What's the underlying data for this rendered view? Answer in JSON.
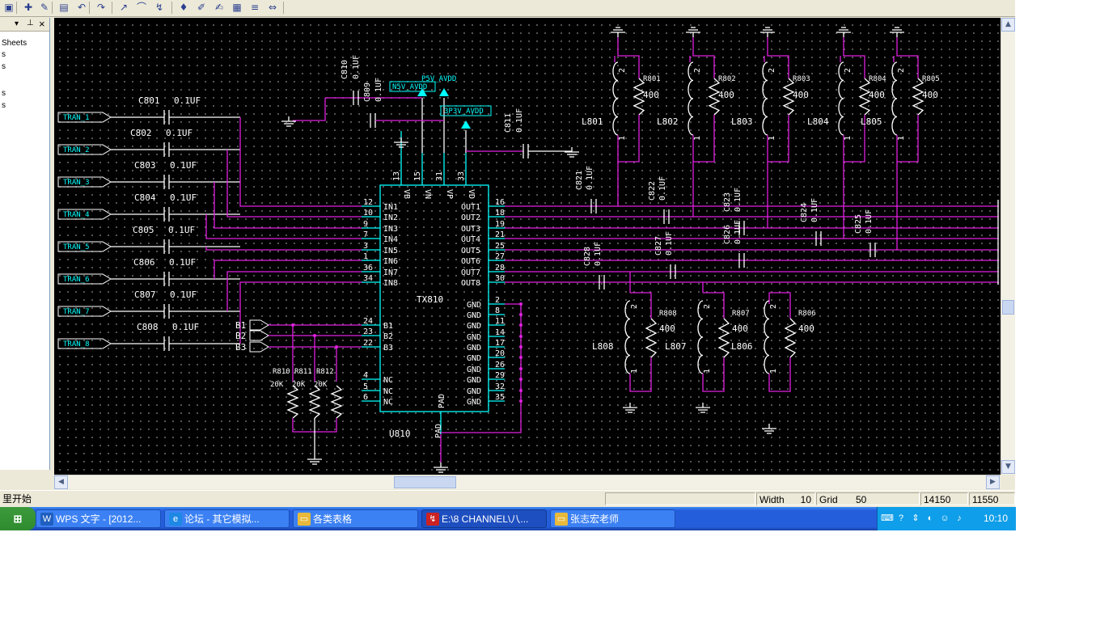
{
  "toolbar": {
    "icons": [
      "sheet-icon",
      "place-part-icon",
      "place-wire-icon",
      "clipboard-icon",
      "undo-icon",
      "redo-icon",
      "place-line-icon",
      "place-arc-icon",
      "place-junction-icon",
      "place-power-icon",
      "edit-part-icon",
      "place-text-icon",
      "place-bus-icon",
      "place-net-icon",
      "annotate-icon"
    ]
  },
  "panel": {
    "header": {
      "menu_glyph": "▾",
      "pin_glyph": "⊥",
      "close_glyph": "×"
    },
    "items": [
      "Sheets",
      "s",
      "s",
      "s",
      "s"
    ]
  },
  "status": {
    "left_text": "里开始",
    "width_label": "Width",
    "width_value": "10",
    "grid_label": "Grid",
    "grid_value": "50",
    "x_coord": "14150",
    "y_coord": "11550"
  },
  "taskbar": {
    "start_glyph": "⊞",
    "tasks": [
      {
        "icon": "W",
        "label": "WPS 文字 - [2012...",
        "icon_color": "#1f5fbf"
      },
      {
        "icon": "e",
        "label": "论坛 - 其它模拟...",
        "icon_color": "#1e88e5"
      },
      {
        "icon": "▭",
        "label": "各类表格",
        "icon_color": "#e8b93a"
      },
      {
        "icon": "↯",
        "label": "E:\\8 CHANNEL\\八...",
        "icon_color": "#cc2222"
      },
      {
        "icon": "▭",
        "label": "张志宏老师",
        "icon_color": "#e8b93a"
      }
    ],
    "tray_icons": [
      "keyboard-icon",
      "help-icon",
      "arrow-icon",
      "network-icon",
      "qq-icon",
      "speaker-icon"
    ],
    "clock": "10:10"
  },
  "schematic": {
    "colors": {
      "wire": "#e020e0",
      "part": "#ffffff",
      "label": "#00ffff",
      "pin": "#00ffff",
      "power": "#00ffff",
      "grid": "#6b6b6b",
      "bg": "#000000"
    },
    "chip": {
      "refdes": "U810",
      "part_name": "TX810",
      "top_pins": [
        {
          "num": "13",
          "name": "VB"
        },
        {
          "num": "15",
          "name": "VN"
        },
        {
          "num": "31",
          "name": "VP"
        },
        {
          "num": "33",
          "name": "VD"
        }
      ],
      "left_pins": [
        {
          "num": "12",
          "name": "IN1"
        },
        {
          "num": "10",
          "name": "IN2"
        },
        {
          "num": "9",
          "name": "IN3"
        },
        {
          "num": "7",
          "name": "IN4"
        },
        {
          "num": "3",
          "name": "IN5"
        },
        {
          "num": "1",
          "name": "IN6"
        },
        {
          "num": "36",
          "name": "IN7"
        },
        {
          "num": "34",
          "name": "IN8"
        },
        {
          "num": "24",
          "name": "B1"
        },
        {
          "num": "23",
          "name": "B2"
        },
        {
          "num": "22",
          "name": "B3"
        },
        {
          "num": "4",
          "name": "NC"
        },
        {
          "num": "5",
          "name": "NC"
        },
        {
          "num": "6",
          "name": "NC"
        }
      ],
      "right_pins": [
        {
          "num": "16",
          "name": "OUT1"
        },
        {
          "num": "18",
          "name": "OUT2"
        },
        {
          "num": "19",
          "name": "OUT3"
        },
        {
          "num": "21",
          "name": "OUT4"
        },
        {
          "num": "25",
          "name": "OUT5"
        },
        {
          "num": "27",
          "name": "OUT6"
        },
        {
          "num": "28",
          "name": "OUT7"
        },
        {
          "num": "30",
          "name": "OUT8"
        },
        {
          "num": "2",
          "name": "GND"
        },
        {
          "num": "8",
          "name": "GND"
        },
        {
          "num": "11",
          "name": "GND"
        },
        {
          "num": "14",
          "name": "GND"
        },
        {
          "num": "17",
          "name": "GND"
        },
        {
          "num": "20",
          "name": "GND"
        },
        {
          "num": "26",
          "name": "GND"
        },
        {
          "num": "29",
          "name": "GND"
        },
        {
          "num": "32",
          "name": "GND"
        },
        {
          "num": "35",
          "name": "GND"
        }
      ],
      "pad_label": "PAD",
      "pad_pin": "PAD"
    },
    "inputs": [
      "TRAN_1",
      "TRAN_2",
      "TRAN_3",
      "TRAN_4",
      "TRAN_5",
      "TRAN_6",
      "TRAN_7",
      "TRAN_8"
    ],
    "input_caps": [
      {
        "ref": "C801",
        "value": "0.1UF"
      },
      {
        "ref": "C802",
        "value": "0.1UF"
      },
      {
        "ref": "C803",
        "value": "0.1UF"
      },
      {
        "ref": "C804",
        "value": "0.1UF"
      },
      {
        "ref": "C805",
        "value": "0.1UF"
      },
      {
        "ref": "C806",
        "value": "0.1UF"
      },
      {
        "ref": "C807",
        "value": "0.1UF"
      },
      {
        "ref": "C808",
        "value": "0.1UF"
      }
    ],
    "b_ports": [
      "B1",
      "B2",
      "B3"
    ],
    "b_resistors": [
      {
        "ref": "R810",
        "value": "20K"
      },
      {
        "ref": "R811",
        "value": "20K"
      },
      {
        "ref": "R812",
        "value": "20K"
      }
    ],
    "power_nets": {
      "p5v": "P5V_AVDD",
      "n5v": "N5V_AVDD",
      "p3v3": "3P3V_AVDD"
    },
    "supply_caps": [
      {
        "ref": "C810",
        "value": "0.1UF"
      },
      {
        "ref": "C809",
        "value": "0.1UF"
      },
      {
        "ref": "C811",
        "value": "0.1UF"
      }
    ],
    "output_caps": [
      {
        "ref": "C821",
        "value": "0.1UF"
      },
      {
        "ref": "C822",
        "value": "0.1UF"
      },
      {
        "ref": "C823",
        "value": "0.1UF"
      },
      {
        "ref": "C824",
        "value": "0.1UF"
      },
      {
        "ref": "C825",
        "value": "0.1UF"
      },
      {
        "ref": "C826",
        "value": "0.1UF"
      },
      {
        "ref": "C827",
        "value": "0.1UF"
      },
      {
        "ref": "C828",
        "value": "0.1UF"
      }
    ],
    "top_coils": [
      {
        "l": "L801",
        "r": "R801",
        "rv": "400"
      },
      {
        "l": "L802",
        "r": "R802",
        "rv": "400"
      },
      {
        "l": "L803",
        "r": "R803",
        "rv": "400"
      },
      {
        "l": "L804",
        "r": "R804",
        "rv": "400"
      },
      {
        "l": "L805",
        "r": "R805",
        "rv": "400"
      }
    ],
    "bottom_coils": [
      {
        "l": "L808",
        "r": "R808",
        "rv": "400"
      },
      {
        "l": "L807",
        "r": "R807",
        "rv": "400"
      },
      {
        "l": "L806",
        "r": "R806",
        "rv": "400"
      }
    ],
    "coil_pins": {
      "top": "2",
      "bottom": "1"
    }
  }
}
